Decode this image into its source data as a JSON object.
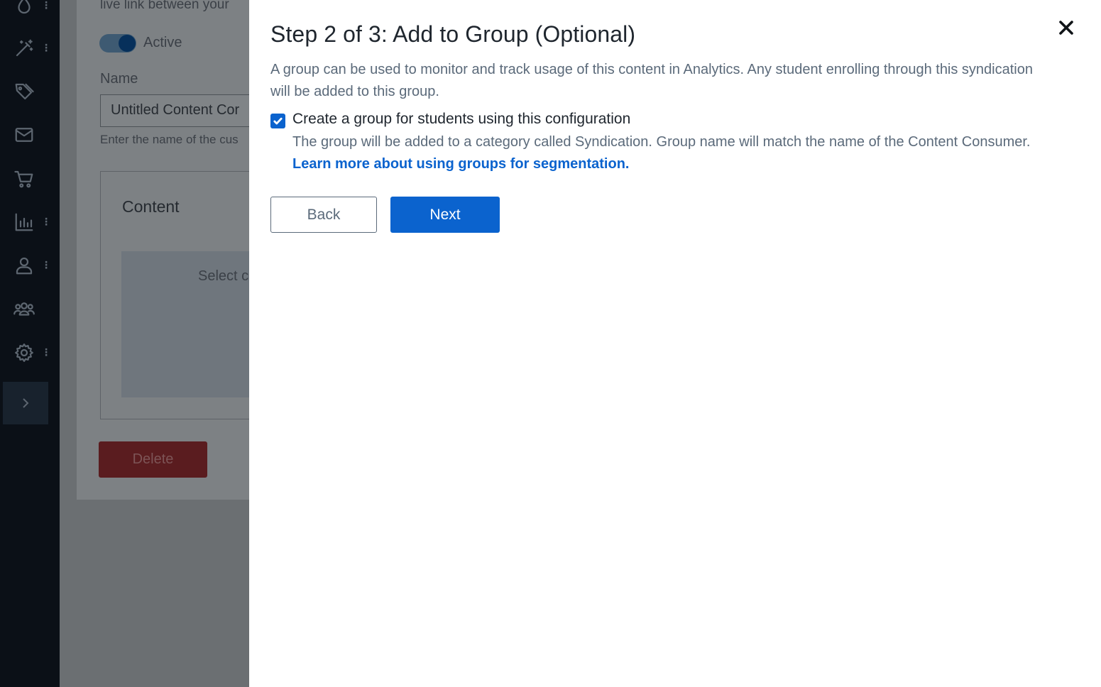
{
  "sidebar": {
    "items": [
      {
        "icon": "drop-icon"
      },
      {
        "icon": "magic-wand-icon"
      },
      {
        "icon": "tag-icon"
      },
      {
        "icon": "mail-icon"
      },
      {
        "icon": "cart-icon"
      },
      {
        "icon": "bar-chart-icon"
      },
      {
        "icon": "user-icon"
      },
      {
        "icon": "users-group-icon"
      },
      {
        "icon": "gear-icon"
      }
    ],
    "expand_icon": "chevron-right-icon"
  },
  "background": {
    "intro_fragment": "live link between your",
    "toggle_label": "Active",
    "name_label": "Name",
    "name_value": "Untitled Content Cor",
    "name_help": "Enter the name of the cus",
    "content_heading": "Content",
    "select_placeholder": "Select c",
    "delete_label": "Delete"
  },
  "modal": {
    "title": "Step 2 of 3: Add to Group (Optional)",
    "description": "A group can be used to monitor and track usage of this content in Analytics. Any student enrolling through this syndication will be added to this group.",
    "checkbox": {
      "checked": true,
      "label": "Create a group for students using this configuration",
      "help_text": "The group will be added to a category called Syndication. Group name will match the name of the Content Consumer.",
      "help_link": "Learn more about using groups for segmentation."
    },
    "back_label": "Back",
    "next_label": "Next"
  },
  "colors": {
    "primary": "#0b63ce",
    "sidebar_bg": "#0b1017",
    "delete_bg": "#5a1c1f",
    "text_dark": "#1f262e",
    "text_muted": "#5b6a7a"
  }
}
